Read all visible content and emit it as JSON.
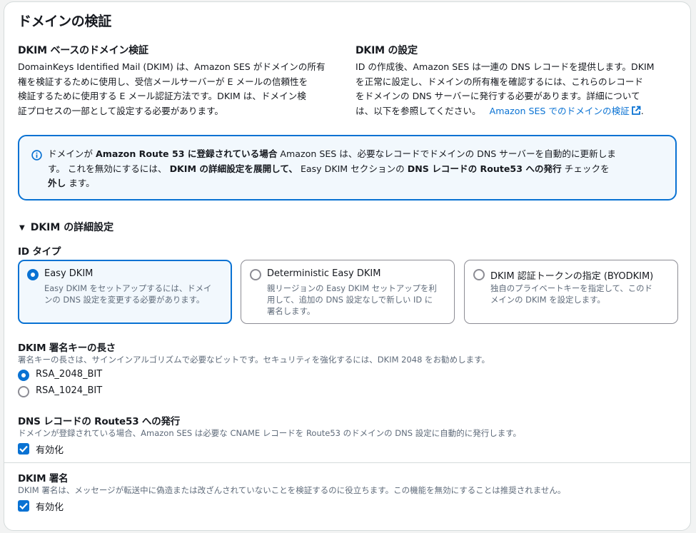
{
  "page_title": "ドメインの検証",
  "dkim_base": {
    "heading": "DKIM ベースのドメイン検証",
    "lines": [
      "DomainKeys Identified Mail (DKIM) は、Amazon SES がドメインの所有",
      "権を検証するために使用し、受信メールサーバーが E メールの信頼性を",
      "検証するために使用する E メール認証方法です。DKIM は、ドメイン検",
      "証プロセスの一部として設定する必要があります。"
    ]
  },
  "dkim_settings": {
    "heading": "DKIM の設定",
    "lines": [
      "ID の作成後、Amazon SES は一連の DNS レコードを提供します。DKIM",
      "を正常に設定し、ドメインの所有権を確認するには、これらのレコード",
      "をドメインの DNS サーバーに発行する必要があります。詳細について"
    ],
    "last_line_text": "は、以下を参照してください。",
    "link_text": "Amazon SES でのドメインの検証",
    "after_link": "."
  },
  "alert": {
    "icon": "info-icon",
    "l1_a": "ドメインが ",
    "l1_b": "Amazon Route 53 に登録されている場合",
    "l1_c": " Amazon SES は、必要なレコードでドメインの DNS サーバーを自動的に更新しま",
    "l2_a": "す。 これを無効にするには、 ",
    "l2_b": "DKIM の詳細設定を展開して、",
    "l2_c": " Easy DKIM セクションの ",
    "l2_d": "DNS レコードの Route53 への発行",
    "l2_e": " チェックを",
    "l3_a": "外し",
    "l3_b": " ます。"
  },
  "advanced": {
    "toggle_label": "DKIM の詳細設定",
    "id_type": {
      "label": "ID タイプ",
      "options": [
        {
          "title": "Easy DKIM",
          "desc1": "Easy DKIM をセットアップするには、ドメイ",
          "desc2": "ンの DNS 設定を変更する必要があります。",
          "desc3": "",
          "selected": true
        },
        {
          "title": "Deterministic Easy DKIM",
          "desc1": "親リージョンの Easy DKIM セットアップを利",
          "desc2": "用して、追加の DNS 設定なしで新しい ID に",
          "desc3": "署名します。",
          "selected": false
        },
        {
          "title": "DKIM 認証トークンの指定 (BYODKIM)",
          "desc1": "独自のプライベートキーを指定して、このド",
          "desc2": "メインの DKIM を設定します。",
          "desc3": "",
          "selected": false
        }
      ]
    },
    "key_length": {
      "label": "DKIM 署名キーの長さ",
      "description": "署名キーの長さは、サインインアルゴリズムで必要なビットです。セキュリティを強化するには、DKIM 2048 をお勧めします。",
      "options": [
        {
          "label": "RSA_2048_BIT",
          "selected": true
        },
        {
          "label": "RSA_1024_BIT",
          "selected": false
        }
      ]
    },
    "route53": {
      "label": "DNS レコードの Route53 への発行",
      "description": "ドメインが登録されている場合、Amazon SES は必要な CNAME レコードを Route53 のドメインの DNS 設定に自動的に発行します。",
      "checkbox_label": "有効化",
      "checked": true
    },
    "signing": {
      "label": "DKIM 署名",
      "description": "DKIM 署名は、メッセージが転送中に偽造または改ざんされていないことを検証するのに役立ちます。この機能を無効にすることは推奨されません。",
      "checkbox_label": "有効化",
      "checked": true
    }
  },
  "colors": {
    "accent": "#0972d3",
    "alert_bg": "#f2f8fd",
    "muted_text": "#5f6b7a",
    "border": "#8c8c94"
  }
}
